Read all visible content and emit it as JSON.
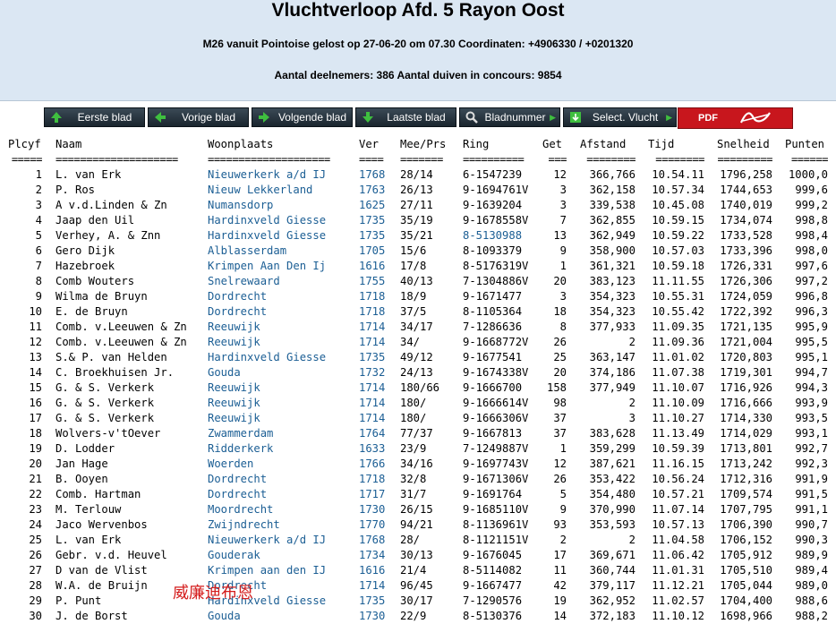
{
  "header": {
    "title": "Vluchtverloop Afd. 5 Rayon Oost",
    "line1": "M26 vanuit Pointoise gelost op 27-06-20 om 07.30 Coordinaten: +4906330 / +0201320",
    "line2": "Aantal deelnemers: 386 Aantal duiven in concours: 9854"
  },
  "toolbar": {
    "first": "Eerste blad",
    "prev": "Vorige blad",
    "next": "Volgende blad",
    "last": "Laatste blad",
    "page": "Bladnummer",
    "select": "Select. Vlucht",
    "pdf": "PDF"
  },
  "columns": [
    "Plcyf",
    "Naam",
    "Woonplaats",
    "Ver",
    "Mee/Prs",
    "Ring",
    "Get",
    "Afstand",
    "Tijd",
    "Snelheid",
    "Punten"
  ],
  "separators": [
    "=====",
    "====================",
    "====================",
    "====",
    "=======",
    "==========",
    "===",
    "========",
    "========",
    "=========",
    "======"
  ],
  "rows": [
    [
      "1",
      "L. van Erk",
      "Nieuwerkerk a/d IJ",
      "1768",
      "28/14",
      "6-1547239",
      "12",
      "366,766",
      "10.54.11",
      "1796,258",
      "1000,0"
    ],
    [
      "2",
      "P. Ros",
      "Nieuw Lekkerland",
      "1763",
      "26/13",
      "9-1694761V",
      "3",
      "362,158",
      "10.57.34",
      "1744,653",
      "999,6"
    ],
    [
      "3",
      "A v.d.Linden & Zn",
      "Numansdorp",
      "1625",
      "27/11",
      "9-1639204",
      "3",
      "339,538",
      "10.45.08",
      "1740,019",
      "999,2"
    ],
    [
      "4",
      "Jaap den Uil",
      "Hardinxveld Giesse",
      "1735",
      "35/19",
      "9-1678558V",
      "7",
      "362,855",
      "10.59.15",
      "1734,074",
      "998,8"
    ],
    [
      "5",
      "Verhey, A. & Znn",
      "Hardinxveld Giesse",
      "1735",
      "35/21",
      "8-5130988",
      "13",
      "362,949",
      "10.59.22",
      "1733,528",
      "998,4"
    ],
    [
      "6",
      "Gero Dijk",
      "Alblasserdam",
      "1705",
      "15/6",
      "8-1093379",
      "9",
      "358,900",
      "10.57.03",
      "1733,396",
      "998,0"
    ],
    [
      "7",
      "Hazebroek",
      "Krimpen Aan Den Ij",
      "1616",
      "17/8",
      "8-5176319V",
      "1",
      "361,321",
      "10.59.18",
      "1726,331",
      "997,6"
    ],
    [
      "8",
      "Comb Wouters",
      "Snelrewaard",
      "1755",
      "40/13",
      "7-1304886V",
      "20",
      "383,123",
      "11.11.55",
      "1726,306",
      "997,2"
    ],
    [
      "9",
      "Wilma de Bruyn",
      "Dordrecht",
      "1718",
      "18/9",
      "9-1671477",
      "3",
      "354,323",
      "10.55.31",
      "1724,059",
      "996,8"
    ],
    [
      "10",
      "E. de Bruyn",
      "Dordrecht",
      "1718",
      "37/5",
      "8-1105364",
      "18",
      "354,323",
      "10.55.42",
      "1722,392",
      "996,3"
    ],
    [
      "11",
      "Comb. v.Leeuwen & Zn",
      "Reeuwijk",
      "1714",
      "34/17",
      "7-1286636",
      "8",
      "377,933",
      "11.09.35",
      "1721,135",
      "995,9"
    ],
    [
      "12",
      "Comb. v.Leeuwen & Zn",
      "Reeuwijk",
      "1714",
      "34/",
      "9-1668772V",
      "26",
      "2",
      "11.09.36",
      "1721,004",
      "995,5"
    ],
    [
      "13",
      "S.& P. van Helden",
      "Hardinxveld Giesse",
      "1735",
      "49/12",
      "9-1677541",
      "25",
      "363,147",
      "11.01.02",
      "1720,803",
      "995,1"
    ],
    [
      "14",
      "C. Broekhuisen Jr.",
      "Gouda",
      "1732",
      "24/13",
      "9-1674338V",
      "20",
      "374,186",
      "11.07.38",
      "1719,301",
      "994,7"
    ],
    [
      "15",
      "G. & S. Verkerk",
      "Reeuwijk",
      "1714",
      "180/66",
      "9-1666700",
      "158",
      "377,949",
      "11.10.07",
      "1716,926",
      "994,3"
    ],
    [
      "16",
      "G. & S. Verkerk",
      "Reeuwijk",
      "1714",
      "180/",
      "9-1666614V",
      "98",
      "2",
      "11.10.09",
      "1716,666",
      "993,9"
    ],
    [
      "17",
      "G. & S. Verkerk",
      "Reeuwijk",
      "1714",
      "180/",
      "9-1666306V",
      "37",
      "3",
      "11.10.27",
      "1714,330",
      "993,5"
    ],
    [
      "18",
      "Wolvers-v'tOever",
      "Zwammerdam",
      "1764",
      "77/37",
      "9-1667813",
      "37",
      "383,628",
      "11.13.49",
      "1714,029",
      "993,1"
    ],
    [
      "19",
      "D. Lodder",
      "Ridderkerk",
      "1633",
      "23/9",
      "7-1249887V",
      "1",
      "359,299",
      "10.59.39",
      "1713,801",
      "992,7"
    ],
    [
      "20",
      "Jan Hage",
      "Woerden",
      "1766",
      "34/16",
      "9-1697743V",
      "12",
      "387,621",
      "11.16.15",
      "1713,242",
      "992,3"
    ],
    [
      "21",
      "B. Ooyen",
      "Dordrecht",
      "1718",
      "32/8",
      "9-1671306V",
      "26",
      "353,422",
      "10.56.24",
      "1712,316",
      "991,9"
    ],
    [
      "22",
      "Comb. Hartman",
      "Dordrecht",
      "1717",
      "31/7",
      "9-1691764",
      "5",
      "354,480",
      "10.57.21",
      "1709,574",
      "991,5"
    ],
    [
      "23",
      "M. Terlouw",
      "Moordrecht",
      "1730",
      "26/15",
      "9-1685110V",
      "9",
      "370,990",
      "11.07.14",
      "1707,795",
      "991,1"
    ],
    [
      "24",
      "Jaco Wervenbos",
      "Zwijndrecht",
      "1770",
      "94/21",
      "8-1136961V",
      "93",
      "353,593",
      "10.57.13",
      "1706,390",
      "990,7"
    ],
    [
      "25",
      "L. van Erk",
      "Nieuwerkerk a/d IJ",
      "1768",
      "28/",
      "8-1121151V",
      "2",
      "2",
      "11.04.58",
      "1706,152",
      "990,3"
    ],
    [
      "26",
      "Gebr. v.d. Heuvel",
      "Gouderak",
      "1734",
      "30/13",
      "9-1676045",
      "17",
      "369,671",
      "11.06.42",
      "1705,912",
      "989,9"
    ],
    [
      "27",
      "D van de Vlist",
      "Krimpen aan den IJ",
      "1616",
      "21/4",
      "8-5114082",
      "11",
      "360,744",
      "11.01.31",
      "1705,510",
      "989,4"
    ],
    [
      "28",
      "W.A. de Bruijn",
      "Dordrecht",
      "1714",
      "96/45",
      "9-1667477",
      "42",
      "379,117",
      "11.12.21",
      "1705,044",
      "989,0"
    ],
    [
      "29",
      "P. Punt",
      "Hardinxveld Giesse",
      "1735",
      "30/17",
      "7-1290576",
      "19",
      "362,952",
      "11.02.57",
      "1704,400",
      "988,6"
    ],
    [
      "30",
      "J. de Borst",
      "Gouda",
      "1730",
      "22/9",
      "8-5130376",
      "14",
      "372,183",
      "11.10.12",
      "1698,966",
      "988,2"
    ]
  ],
  "watermark": "威廉迪布恩",
  "colors": {
    "header_bg": "#dbe7f3",
    "link_blue": "#1b5e94",
    "button_bg": "#212e38",
    "pdf_red": "#c8161d"
  }
}
